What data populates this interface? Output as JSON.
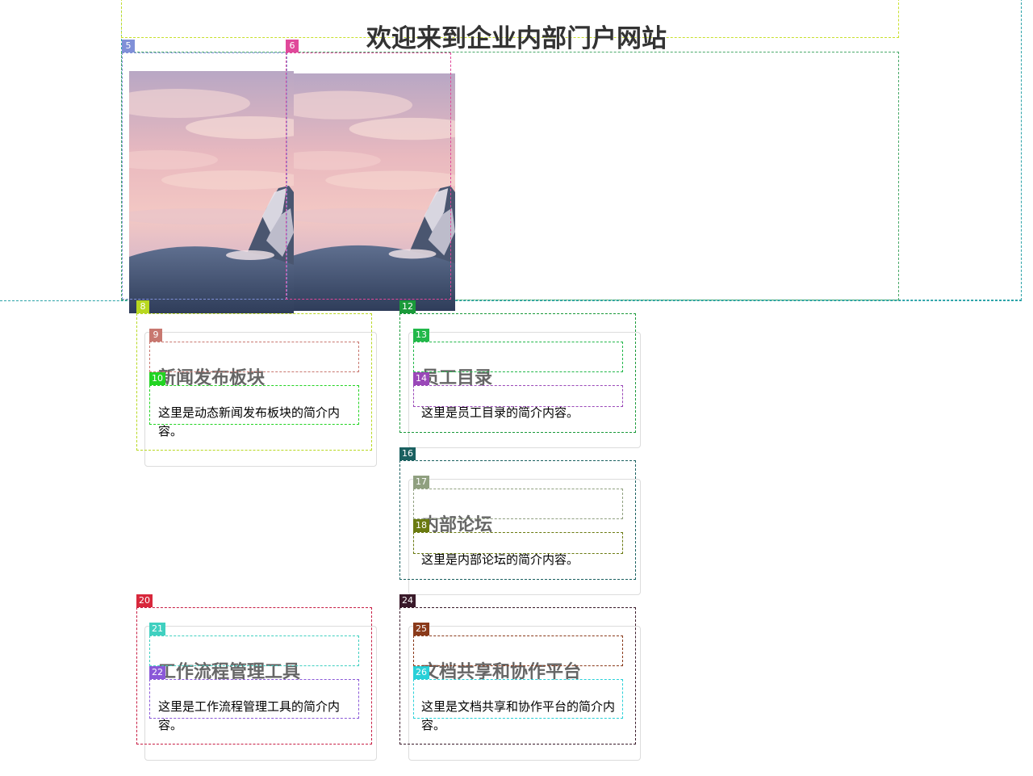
{
  "page": {
    "title": "欢迎来到企业内部门户网站",
    "banner_images": [
      {
        "name": "mountain-photo",
        "description_icon": "image-icon"
      },
      {
        "name": "mountain-photo",
        "description_icon": "image-icon"
      }
    ]
  },
  "cards": [
    {
      "title": "新闻发布板块",
      "desc": "这里是动态新闻发布板块的简介内容。"
    },
    {
      "title": "员工目录",
      "desc": "这里是员工目录的简介内容。"
    },
    {
      "title": "内部论坛",
      "desc": "这里是内部论坛的简介内容。"
    },
    {
      "title": "工作流程管理工具",
      "desc": "这里是工作流程管理工具的简介内容。"
    },
    {
      "title": "文档共享和协作平台",
      "desc": "这里是文档共享和协作平台的简介内容。"
    }
  ],
  "overlay_tags": {
    "t5": "5",
    "t6": "6",
    "t8": "8",
    "t9": "9",
    "t10": "10",
    "t12": "12",
    "t13": "13",
    "t14": "14",
    "t16": "16",
    "t17": "17",
    "t18": "18",
    "t20": "20",
    "t21": "21",
    "t22": "22",
    "t24": "24",
    "t25": "25",
    "t26": "26"
  },
  "colors": {
    "title": "#333333",
    "card_title": "#666666",
    "card_border": "#dcdcdc"
  }
}
